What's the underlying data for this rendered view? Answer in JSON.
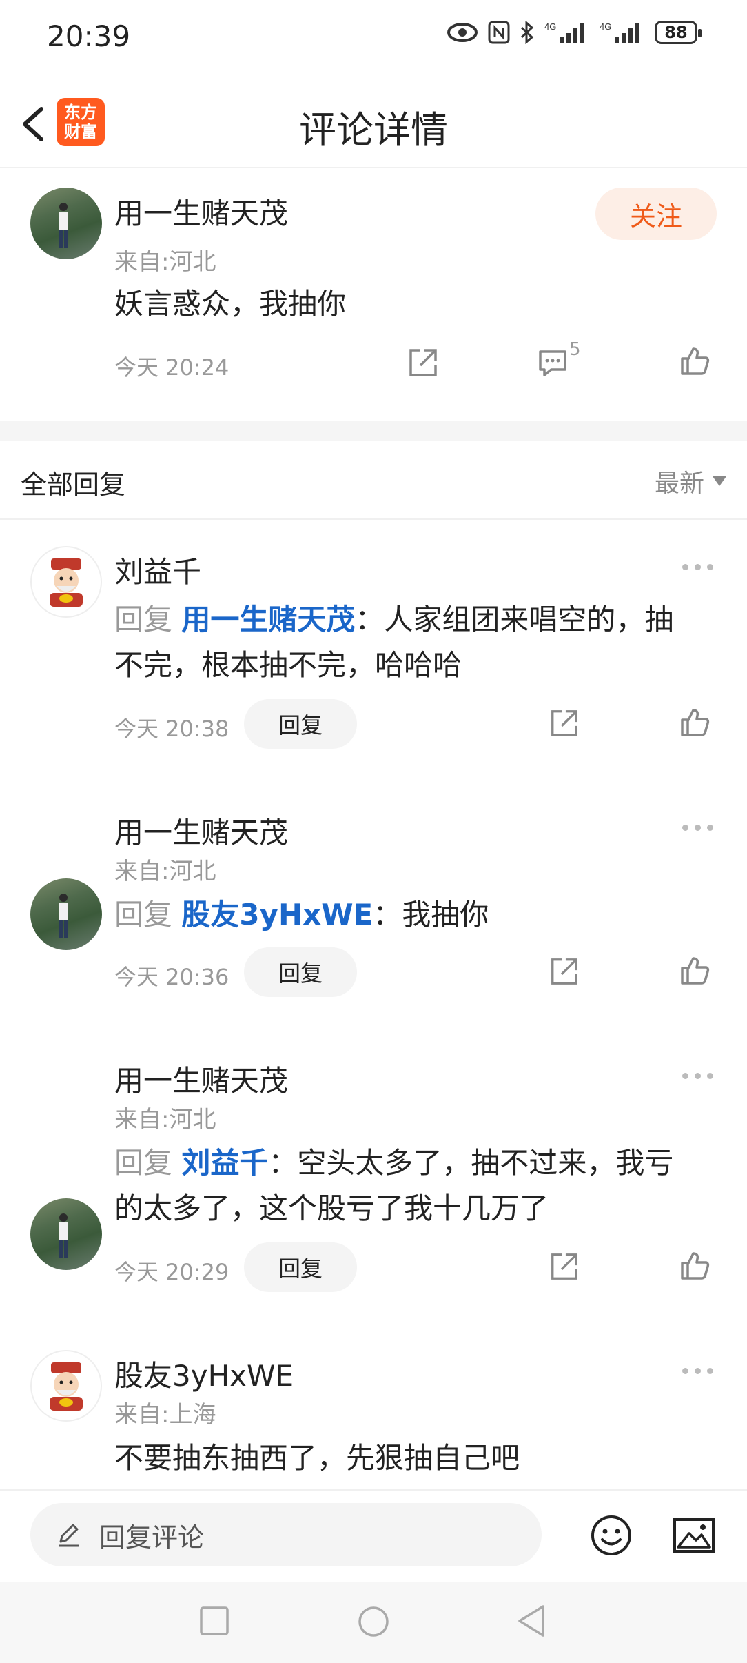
{
  "status_bar": {
    "time": "20:39",
    "battery": "88"
  },
  "header": {
    "title": "评论详情",
    "logo_line1": "东方",
    "logo_line2": "财富"
  },
  "main_comment": {
    "author": "用一生赌天茂",
    "from": "来自:河北",
    "text": "妖言惑众，我抽你",
    "time": "今天 20:24",
    "follow_label": "关注",
    "comment_count": "5"
  },
  "replies_header": {
    "title": "全部回复",
    "sort": "最新"
  },
  "replies": [
    {
      "author": "刘益千",
      "reply_prefix": "回复",
      "reply_to": "用一生赌天茂",
      "line1": "：人家组团来唱空的，抽",
      "line2": "不完，根本抽不完，哈哈哈",
      "time": "今天 20:38",
      "reply_label": "回复"
    },
    {
      "author": "用一生赌天茂",
      "from": "来自:河北",
      "reply_prefix": "回复",
      "reply_to": "股友3yHxWE",
      "line1": "：我抽你",
      "time": "今天 20:36",
      "reply_label": "回复"
    },
    {
      "author": "用一生赌天茂",
      "from": "来自:河北",
      "reply_prefix": "回复",
      "reply_to": "刘益千",
      "line1": "：空头太多了，抽不过来，我亏",
      "line2": "的太多了，这个股亏了我十几万了",
      "time": "今天 20:29",
      "reply_label": "回复"
    },
    {
      "author": "股友3yHxWE",
      "from": "来自:上海",
      "line1": "不要抽东抽西了，先狠抽自己吧"
    }
  ],
  "bottom_bar": {
    "placeholder": "回复评论"
  },
  "colors": {
    "accent": "#ef5a19",
    "link": "#1a66c9",
    "follow_bg": "#fdeee6"
  },
  "icons": [
    "back-icon",
    "eye-icon",
    "nfc-icon",
    "bluetooth-icon",
    "signal-icon",
    "share-icon",
    "comment-icon",
    "like-icon",
    "more-icon",
    "pencil-icon",
    "emoji-icon",
    "image-icon",
    "nav-square-icon",
    "nav-circle-icon",
    "nav-back-icon"
  ]
}
